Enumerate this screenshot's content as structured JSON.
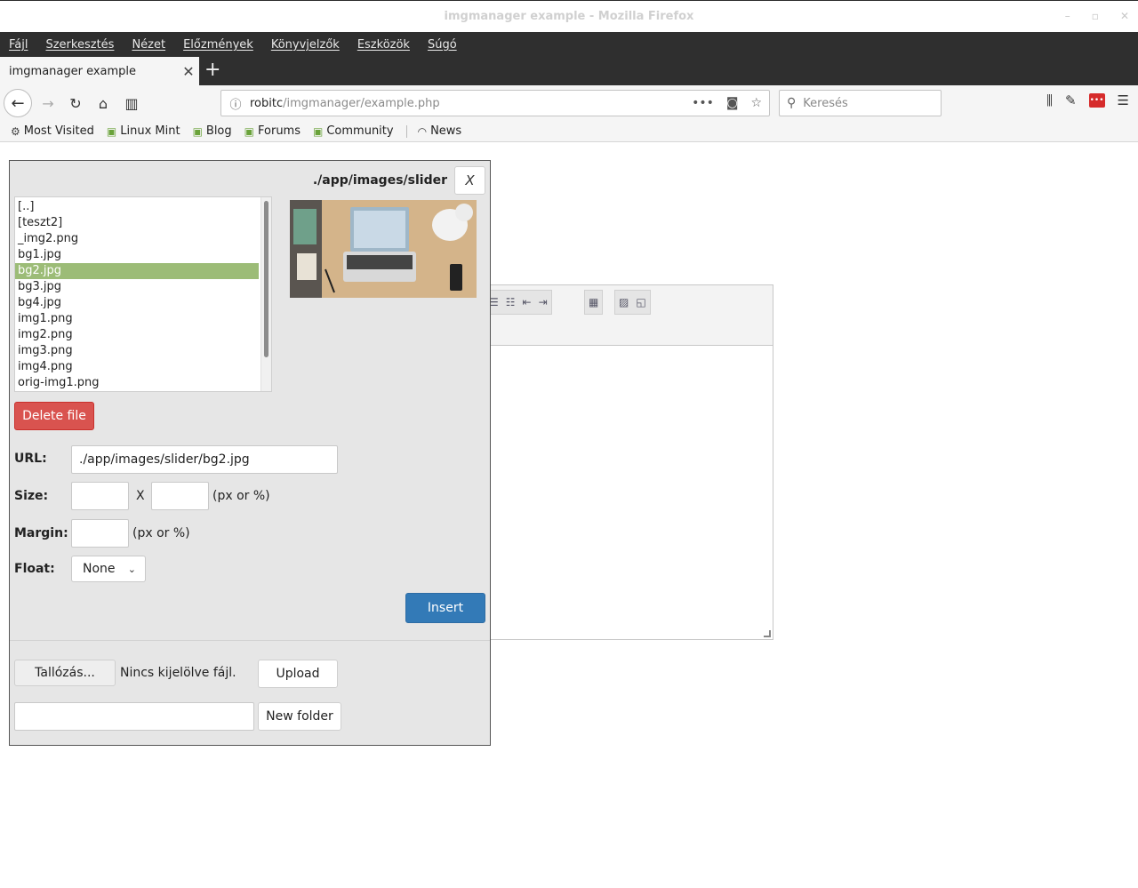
{
  "window": {
    "title": "imgmanager example - Mozilla Firefox"
  },
  "menubar": {
    "items": [
      "Fájl",
      "Szerkesztés",
      "Nézet",
      "Előzmények",
      "Könyvjelzők",
      "Eszközök",
      "Súgó"
    ]
  },
  "tab": {
    "title": "imgmanager example"
  },
  "urlbar": {
    "host": "robitc",
    "path": "/imgmanager/example.php"
  },
  "searchbar": {
    "placeholder": "Keresés"
  },
  "bookmarks": [
    "Most Visited",
    "Linux Mint",
    "Blog",
    "Forums",
    "Community",
    "News"
  ],
  "imgmanager": {
    "current_path": "./app/images/slider",
    "close_label": "X",
    "files": [
      "[..]",
      "[teszt2]",
      "_img2.png",
      "bg1.jpg",
      "bg2.jpg",
      "bg3.jpg",
      "bg4.jpg",
      "img1.png",
      "img2.png",
      "img3.png",
      "img4.png",
      "orig-img1.png"
    ],
    "selected_file": "bg2.jpg",
    "delete_label": "Delete file",
    "url_label": "URL:",
    "url_value": "./app/images/slider/bg2.jpg",
    "size_label": "Size:",
    "size_x": "X",
    "size_unit": "(px or %)",
    "margin_label": "Margin:",
    "margin_unit": "(px or %)",
    "float_label": "Float:",
    "float_value": "None",
    "insert_label": "Insert",
    "browse_label": "Tallózás...",
    "no_file_text": "Nincs kijelölve fájl.",
    "upload_label": "Upload",
    "new_folder_label": "New folder"
  },
  "colors": {
    "selected_row": "#9cbc77",
    "danger": "#d9534f",
    "primary": "#337ab7",
    "menubar_bg": "#2f2f2f"
  }
}
